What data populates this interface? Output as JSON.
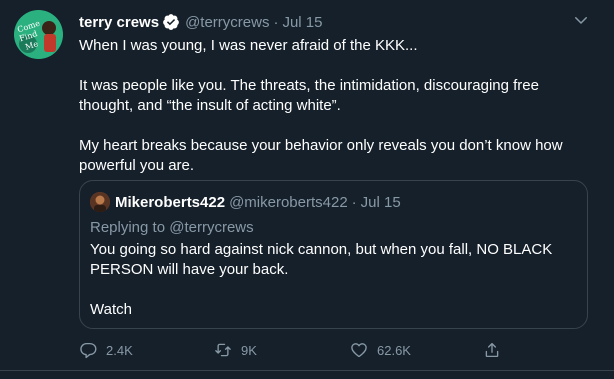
{
  "tweet": {
    "author_name": "terry crews",
    "author_handle": "@terrycrews",
    "separator": "·",
    "date": "Jul 15",
    "avatar_text": "Come Find Me",
    "lines": [
      "When I was young, I was never afraid of the KKK...",
      "It was people like you. The threats, the intimidation,  discouraging free",
      "thought, and “the insult of acting white”.",
      "My heart breaks because your behavior only reveals you don’t know how",
      "powerful you are."
    ]
  },
  "quote": {
    "author_name": "Mikeroberts422",
    "author_handle": "@mikeroberts422",
    "separator": "·",
    "date": "Jul 15",
    "replying_prefix": "Replying to ",
    "replying_handle": "@terrycrews",
    "lines": [
      "You going so hard against nick cannon, but when you fall, NO BLACK",
      "PERSON will have your back.",
      "Watch"
    ]
  },
  "actions": {
    "reply_count": "2.4K",
    "retweet_count": "9K",
    "like_count": "62.6K"
  },
  "icons": {
    "verified": "verified-badge-icon",
    "caret": "chevron-down-icon",
    "reply": "reply-icon",
    "retweet": "retweet-icon",
    "like": "heart-icon",
    "share": "share-icon"
  },
  "colors": {
    "background": "#15202b",
    "text": "#ffffff",
    "secondary": "#8899a6",
    "border": "#38444d",
    "verified": "#ffffff"
  }
}
